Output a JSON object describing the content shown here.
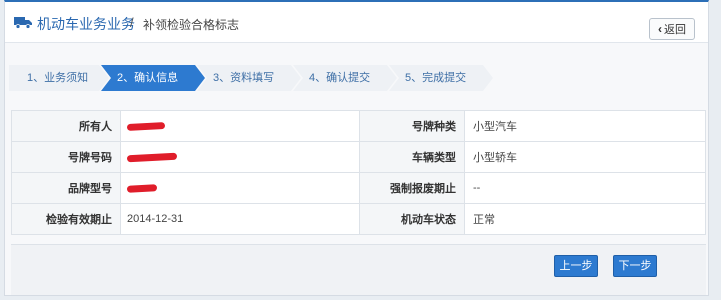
{
  "header": {
    "title_main": "机动车业务业务",
    "separator": "/",
    "title_sub": "补领检验合格标志",
    "back_label": "返回"
  },
  "steps": [
    {
      "label": "1、业务须知",
      "active": false
    },
    {
      "label": "2、确认信息",
      "active": true
    },
    {
      "label": "3、资料填写",
      "active": false
    },
    {
      "label": "4、确认提交",
      "active": false
    },
    {
      "label": "5、完成提交",
      "active": false
    }
  ],
  "info": {
    "rows": [
      {
        "label1": "所有人",
        "value1": "",
        "label2": "号牌种类",
        "value2": "小型汽车"
      },
      {
        "label1": "号牌号码",
        "value1": "",
        "label2": "车辆类型",
        "value2": "小型轿车"
      },
      {
        "label1": "品牌型号",
        "value1": "",
        "label2": "强制报废期止",
        "value2": "--"
      },
      {
        "label1": "检验有效期止",
        "value1": "2014-12-31",
        "label2": "机动车状态",
        "value2": "正常"
      }
    ]
  },
  "footer": {
    "prev_label": "上一步",
    "next_label": "下一步"
  },
  "colors": {
    "accent": "#2d7ad0",
    "title": "#2a68b0",
    "redaction": "#e01d2a"
  }
}
